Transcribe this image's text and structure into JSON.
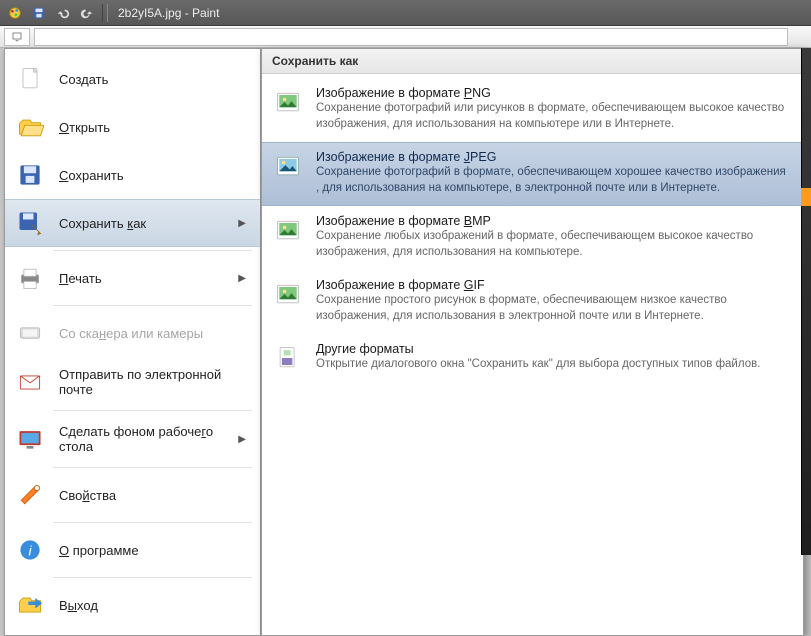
{
  "window": {
    "title": "2b2yI5A.jpg - Paint"
  },
  "file_menu": {
    "items": [
      {
        "label_html": "Создать",
        "disabled": false,
        "sub": false,
        "icon": "new"
      },
      {
        "label_html": "<u>О</u>ткрыть",
        "disabled": false,
        "sub": false,
        "icon": "open"
      },
      {
        "label_html": "<u>С</u>охранить",
        "disabled": false,
        "sub": false,
        "icon": "save"
      },
      {
        "label_html": "Сохранить <u>к</u>ак",
        "disabled": false,
        "sub": true,
        "icon": "saveas",
        "highlight": true
      },
      {
        "label_html": "<u>П</u>ечать",
        "disabled": false,
        "sub": true,
        "icon": "print"
      },
      {
        "label_html": "Со ска<u>н</u>ера или камеры",
        "disabled": true,
        "sub": false,
        "icon": "scanner"
      },
      {
        "label_html": "Отправить по электронной почте",
        "disabled": false,
        "sub": false,
        "icon": "mail"
      },
      {
        "label_html": "Сделать фоном рабоче<u>г</u>о стола",
        "disabled": false,
        "sub": true,
        "icon": "wallpaper"
      },
      {
        "label_html": "Сво<u>й</u>ства",
        "disabled": false,
        "sub": false,
        "icon": "props"
      },
      {
        "label_html": "<u>О</u> программе",
        "disabled": false,
        "sub": false,
        "icon": "about"
      },
      {
        "label_html": "В<u>ы</u>ход",
        "disabled": false,
        "sub": false,
        "icon": "exit"
      }
    ]
  },
  "submenu": {
    "header": "Сохранить как",
    "items": [
      {
        "title_html": "Изображение в формате <u>P</u>NG",
        "desc": "Сохранение фотографий или рисунков в формате, обеспечивающем высокое качество изображения, для использования на компьютере или в Интернете.",
        "selected": false,
        "icon": "png"
      },
      {
        "title_html": "Изображение в формате <u>J</u>PEG",
        "desc": "Сохранение фотографий в формате, обеспечивающем хорошее качество изображения , для использования на компьютере, в электронной почте или в Интернете.",
        "selected": true,
        "icon": "jpeg"
      },
      {
        "title_html": "Изображение в формате <u>B</u>MP",
        "desc": "Сохранение любых изображений в формате, обеспечивающем высокое качество изображения, для использования на компьютере.",
        "selected": false,
        "icon": "bmp"
      },
      {
        "title_html": "Изображение в формате <u>G</u>IF",
        "desc": "Сохранение простого рисунок в формате, обеспечивающем низкое качество изображения, для использования в электронной почте или в Интернете.",
        "selected": false,
        "icon": "gif"
      },
      {
        "title_html": "<u>Д</u>ругие форматы",
        "desc": "Открытие диалогового окна \"Сохранить как\" для выбора доступных типов файлов.",
        "selected": false,
        "icon": "other"
      }
    ]
  }
}
